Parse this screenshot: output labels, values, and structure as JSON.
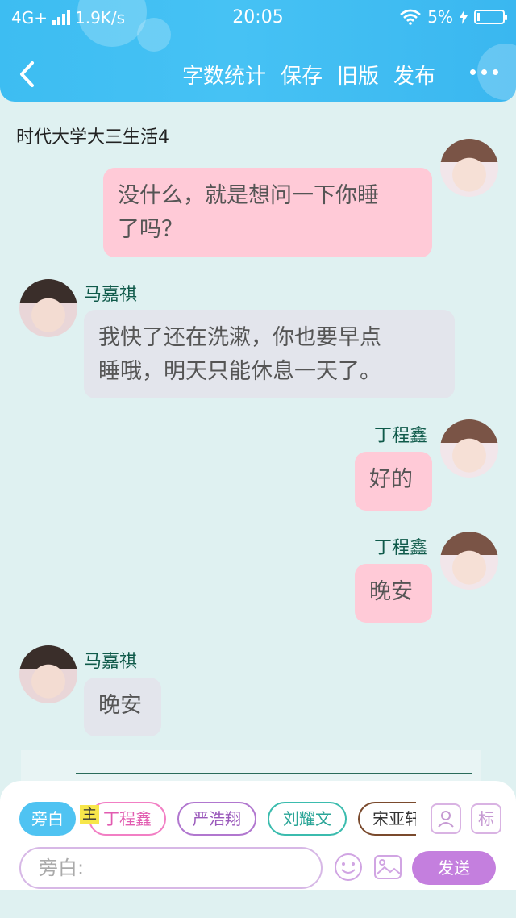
{
  "status_bar": {
    "network": "4G+",
    "speed": "1.9K/s",
    "time": "20:05",
    "battery": "5%"
  },
  "header": {
    "nav_items": [
      "字数统计",
      "保存",
      "旧版",
      "发布"
    ]
  },
  "document": {
    "title": "时代大学大三生活4"
  },
  "messages": [
    {
      "side": "right",
      "name": "",
      "text_lines": [
        "没什么，就是想问一下你睡",
        "了吗？"
      ]
    },
    {
      "side": "left",
      "name": "马嘉祺",
      "text_lines": [
        "我快了还在洗漱，你也要早点",
        "睡哦，明天只能休息一天了。"
      ]
    },
    {
      "side": "right",
      "name": "丁程鑫",
      "text_lines": [
        "好的"
      ]
    },
    {
      "side": "right",
      "name": "丁程鑫",
      "text_lines": [
        "晚安"
      ]
    },
    {
      "side": "left",
      "name": "马嘉祺",
      "text_lines": [
        "晚安"
      ]
    }
  ],
  "roles": {
    "narration": "旁白",
    "main_tag": "主",
    "items": [
      "丁程鑫",
      "严浩翔",
      "刘耀文",
      "宋亚轩"
    ]
  },
  "icons": {
    "contact": "contact-icon",
    "tag": "标",
    "emoji": "emoji-icon",
    "image": "image-icon"
  },
  "composer": {
    "placeholder": "旁白:",
    "send_label": "发送"
  },
  "colors": {
    "header": "#3dbdf2",
    "right_bubble": "#ffcad7",
    "left_bubble": "#e3e5ec",
    "name_text": "#0f5a4a",
    "send": "#c47fde"
  }
}
